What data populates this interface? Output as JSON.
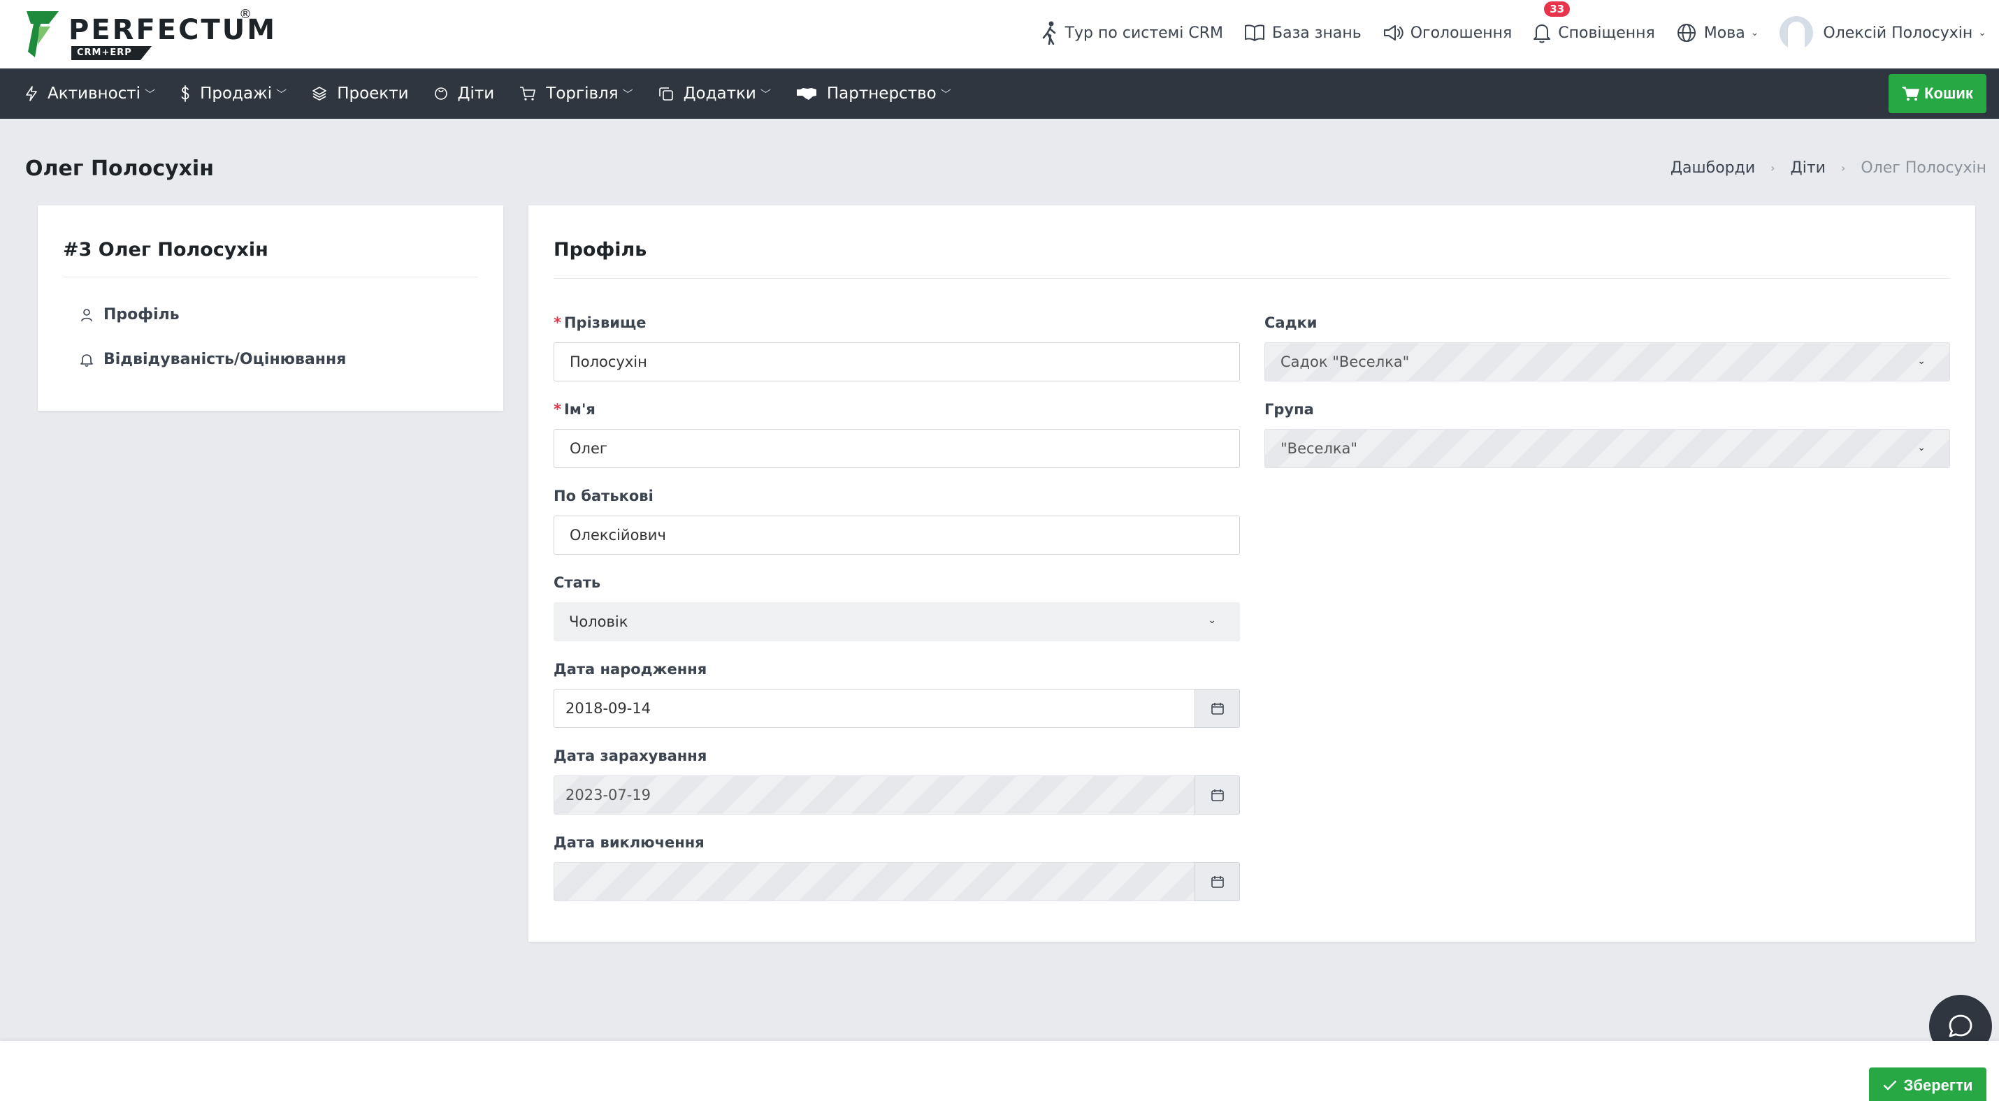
{
  "brand": {
    "name": "PERFECTUM",
    "registered": "®",
    "sub": "CRM+ERP",
    "color": "#1e8a3c"
  },
  "topnav": {
    "tour": "Тур по системі CRM",
    "knowledge": "База знань",
    "announcements": "Оголошення",
    "notifications": "Сповіщення",
    "notifications_count": "33",
    "language": "Мова",
    "user": "Олексій Полосухін"
  },
  "menu": {
    "activities": "Активності",
    "sales": "Продажі",
    "projects": "Проекти",
    "children": "Діти",
    "trade": "Торгівля",
    "addons": "Додатки",
    "partnership": "Партнерство",
    "cart": "Кошик"
  },
  "page": {
    "title": "Олег Полосухін",
    "breadcrumb": [
      "Дашборди",
      "Діти",
      "Олег Полосухін"
    ]
  },
  "sidebar": {
    "title": "#3 Олег Полосухін",
    "items": [
      {
        "label": "Профіль",
        "icon": "user-icon"
      },
      {
        "label": "Відвідуваність/Оцінювання",
        "icon": "bell-icon"
      }
    ]
  },
  "profile": {
    "title": "Профіль",
    "surname_label": "Прізвище",
    "surname_value": "Полосухін",
    "name_label": "Ім'я",
    "name_value": "Олег",
    "patronymic_label": "По батькові",
    "patronymic_value": "Олексійович",
    "gender_label": "Стать",
    "gender_value": "Чоловік",
    "birth_label": "Дата народження",
    "birth_value": "2018-09-14",
    "enroll_label": "Дата зарахування",
    "enroll_value": "2023-07-19",
    "exclude_label": "Дата виключення",
    "exclude_value": "",
    "kindergarten_label": "Садки",
    "kindergarten_value": "Садок \"Веселка\"",
    "group_label": "Група",
    "group_value": "\"Веселка\""
  },
  "actions": {
    "save": "Зберегти"
  },
  "colors": {
    "accent": "#28a745",
    "menubar": "#2f3640",
    "badge": "#e8344a"
  }
}
